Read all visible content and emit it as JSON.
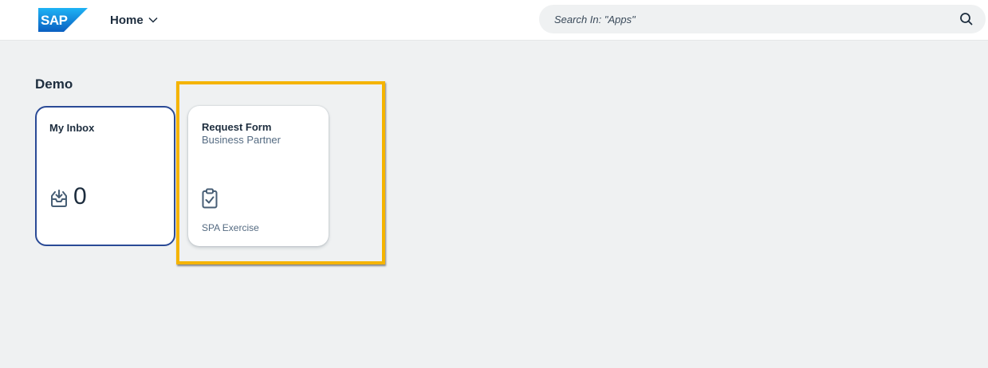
{
  "shellbar": {
    "logo_text": "SAP",
    "home_label": "Home",
    "search_placeholder": "Search In: \"Apps\""
  },
  "colors": {
    "brand": "#0a6ed1",
    "background": "#eff1f2",
    "tile_border_active": "#2a4a96",
    "highlight": "#f5b400"
  },
  "group": {
    "title": "Demo",
    "tiles": [
      {
        "title": "My Inbox",
        "icon": "inbox-download-icon",
        "count": "0"
      },
      {
        "title": "Request Form",
        "subtitle": "Business Partner",
        "icon": "clipboard-check-icon",
        "footer": "SPA Exercise"
      }
    ]
  }
}
